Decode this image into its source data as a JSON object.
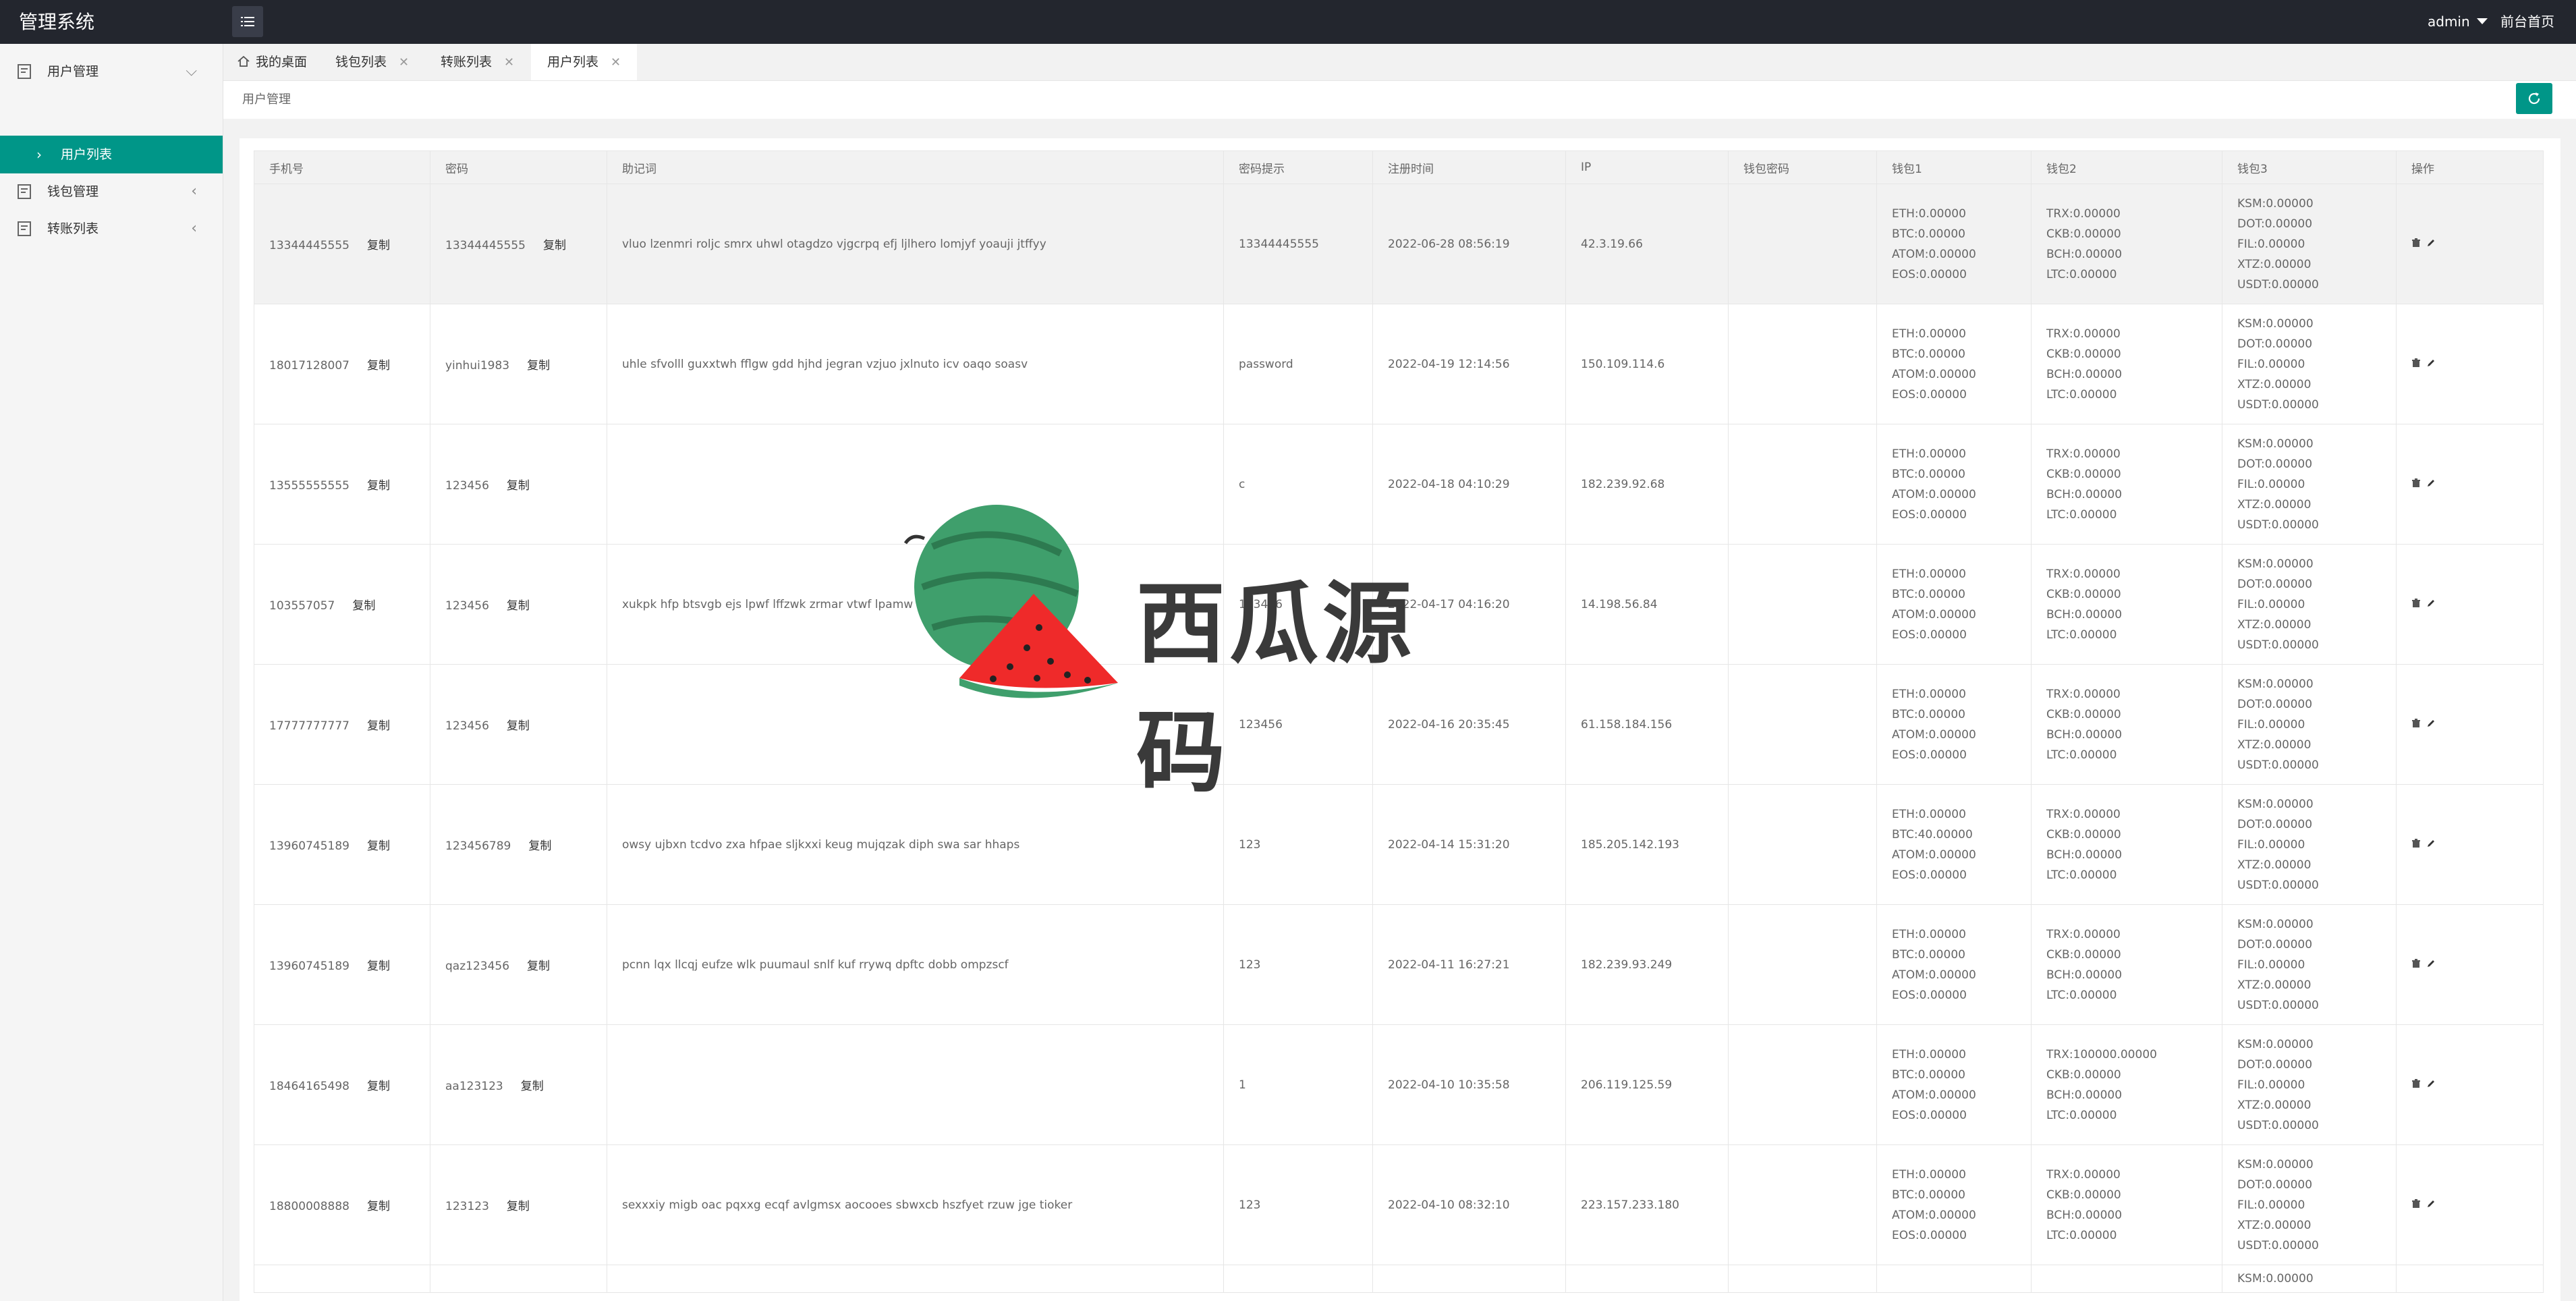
{
  "header": {
    "app_title": "管理系统",
    "user": "admin",
    "front_link": "前台首页"
  },
  "sidebar": {
    "items": [
      {
        "label": "用户管理"
      },
      {
        "label": "钱包管理"
      },
      {
        "label": "转账列表"
      }
    ],
    "sub_item": "用户列表"
  },
  "tabs": [
    {
      "label": "我的桌面"
    },
    {
      "label": "钱包列表"
    },
    {
      "label": "转账列表"
    },
    {
      "label": "用户列表"
    }
  ],
  "breadcrumb": "用户管理",
  "table": {
    "columns": [
      "手机号",
      "密码",
      "助记词",
      "密码提示",
      "注册时间",
      "IP",
      "钱包密码",
      "钱包1",
      "钱包2",
      "钱包3",
      "操作"
    ],
    "copy_label": "复制",
    "rows": [
      {
        "phone": "13344445555",
        "password": "13344445555",
        "mnemonic": "vluo lzenmri roljc smrx uhwl otagdzo vjgcrpq efj ljlhero lomjyf yoauji jtffyy",
        "hint": "13344445555",
        "reg_time": "2022-06-28 08:56:19",
        "ip": "42.3.19.66",
        "wallet_pwd": "",
        "w1": [
          "ETH:0.00000",
          "BTC:0.00000",
          "ATOM:0.00000",
          "EOS:0.00000"
        ],
        "w2": [
          "TRX:0.00000",
          "CKB:0.00000",
          "BCH:0.00000",
          "LTC:0.00000"
        ],
        "w3": [
          "KSM:0.00000",
          "DOT:0.00000",
          "FIL:0.00000",
          "XTZ:0.00000",
          "USDT:0.00000"
        ]
      },
      {
        "phone": "18017128007",
        "password": "yinhui1983",
        "mnemonic": "uhle sfvolll guxxtwh fflgw gdd hjhd jegran vzjuo jxlnuto icv oaqo soasv",
        "hint": "password",
        "reg_time": "2022-04-19 12:14:56",
        "ip": "150.109.114.6",
        "wallet_pwd": "",
        "w1": [
          "ETH:0.00000",
          "BTC:0.00000",
          "ATOM:0.00000",
          "EOS:0.00000"
        ],
        "w2": [
          "TRX:0.00000",
          "CKB:0.00000",
          "BCH:0.00000",
          "LTC:0.00000"
        ],
        "w3": [
          "KSM:0.00000",
          "DOT:0.00000",
          "FIL:0.00000",
          "XTZ:0.00000",
          "USDT:0.00000"
        ]
      },
      {
        "phone": "13555555555",
        "password": "123456",
        "mnemonic": "",
        "hint": "c",
        "reg_time": "2022-04-18 04:10:29",
        "ip": "182.239.92.68",
        "wallet_pwd": "",
        "w1": [
          "ETH:0.00000",
          "BTC:0.00000",
          "ATOM:0.00000",
          "EOS:0.00000"
        ],
        "w2": [
          "TRX:0.00000",
          "CKB:0.00000",
          "BCH:0.00000",
          "LTC:0.00000"
        ],
        "w3": [
          "KSM:0.00000",
          "DOT:0.00000",
          "FIL:0.00000",
          "XTZ:0.00000",
          "USDT:0.00000"
        ]
      },
      {
        "phone": "103557057",
        "password": "123456",
        "mnemonic": "xukpk hfp btsvgb ejs lpwf lffzwk zrmar vtwf lpamw qfgp",
        "hint": "123456",
        "reg_time": "2022-04-17 04:16:20",
        "ip": "14.198.56.84",
        "wallet_pwd": "",
        "w1": [
          "ETH:0.00000",
          "BTC:0.00000",
          "ATOM:0.00000",
          "EOS:0.00000"
        ],
        "w2": [
          "TRX:0.00000",
          "CKB:0.00000",
          "BCH:0.00000",
          "LTC:0.00000"
        ],
        "w3": [
          "KSM:0.00000",
          "DOT:0.00000",
          "FIL:0.00000",
          "XTZ:0.00000",
          "USDT:0.00000"
        ]
      },
      {
        "phone": "17777777777",
        "password": "123456",
        "mnemonic": "",
        "hint": "123456",
        "reg_time": "2022-04-16 20:35:45",
        "ip": "61.158.184.156",
        "wallet_pwd": "",
        "w1": [
          "ETH:0.00000",
          "BTC:0.00000",
          "ATOM:0.00000",
          "EOS:0.00000"
        ],
        "w2": [
          "TRX:0.00000",
          "CKB:0.00000",
          "BCH:0.00000",
          "LTC:0.00000"
        ],
        "w3": [
          "KSM:0.00000",
          "DOT:0.00000",
          "FIL:0.00000",
          "XTZ:0.00000",
          "USDT:0.00000"
        ]
      },
      {
        "phone": "13960745189",
        "password": "123456789",
        "mnemonic": "owsy ujbxn tcdvo zxa hfpae sljkxxi keug mujqzak diph swa sar hhaps",
        "hint": "123",
        "reg_time": "2022-04-14 15:31:20",
        "ip": "185.205.142.193",
        "wallet_pwd": "",
        "w1": [
          "ETH:0.00000",
          "BTC:40.00000",
          "ATOM:0.00000",
          "EOS:0.00000"
        ],
        "w2": [
          "TRX:0.00000",
          "CKB:0.00000",
          "BCH:0.00000",
          "LTC:0.00000"
        ],
        "w3": [
          "KSM:0.00000",
          "DOT:0.00000",
          "FIL:0.00000",
          "XTZ:0.00000",
          "USDT:0.00000"
        ]
      },
      {
        "phone": "13960745189",
        "password": "qaz123456",
        "mnemonic": "pcnn lqx llcqj eufze wlk puumaul snlf kuf rrywq dpftc dobb ompzscf",
        "hint": "123",
        "reg_time": "2022-04-11 16:27:21",
        "ip": "182.239.93.249",
        "wallet_pwd": "",
        "w1": [
          "ETH:0.00000",
          "BTC:0.00000",
          "ATOM:0.00000",
          "EOS:0.00000"
        ],
        "w2": [
          "TRX:0.00000",
          "CKB:0.00000",
          "BCH:0.00000",
          "LTC:0.00000"
        ],
        "w3": [
          "KSM:0.00000",
          "DOT:0.00000",
          "FIL:0.00000",
          "XTZ:0.00000",
          "USDT:0.00000"
        ]
      },
      {
        "phone": "18464165498",
        "password": "aa123123",
        "mnemonic": "",
        "hint": "1",
        "reg_time": "2022-04-10 10:35:58",
        "ip": "206.119.125.59",
        "wallet_pwd": "",
        "w1": [
          "ETH:0.00000",
          "BTC:0.00000",
          "ATOM:0.00000",
          "EOS:0.00000"
        ],
        "w2": [
          "TRX:100000.00000",
          "CKB:0.00000",
          "BCH:0.00000",
          "LTC:0.00000"
        ],
        "w3": [
          "KSM:0.00000",
          "DOT:0.00000",
          "FIL:0.00000",
          "XTZ:0.00000",
          "USDT:0.00000"
        ]
      },
      {
        "phone": "18800008888",
        "password": "123123",
        "mnemonic": "sexxxiy migb oac pqxxg ecqf avlgmsx aocooes sbwxcb hszfyet rzuw jge tioker",
        "hint": "123",
        "reg_time": "2022-04-10 08:32:10",
        "ip": "223.157.233.180",
        "wallet_pwd": "",
        "w1": [
          "ETH:0.00000",
          "BTC:0.00000",
          "ATOM:0.00000",
          "EOS:0.00000"
        ],
        "w2": [
          "TRX:0.00000",
          "CKB:0.00000",
          "BCH:0.00000",
          "LTC:0.00000"
        ],
        "w3": [
          "KSM:0.00000",
          "DOT:0.00000",
          "FIL:0.00000",
          "XTZ:0.00000",
          "USDT:0.00000"
        ]
      },
      {
        "phone": "",
        "password": "",
        "mnemonic": "",
        "hint": "",
        "reg_time": "",
        "ip": "",
        "wallet_pwd": "",
        "w1": [],
        "w2": [],
        "w3": [
          "KSM:0.00000"
        ]
      }
    ]
  },
  "watermark": {
    "text": "西瓜源码"
  },
  "colors": {
    "topbar": "#23262e",
    "accent": "#009688",
    "sidebar_bg": "#f5f5f5"
  }
}
